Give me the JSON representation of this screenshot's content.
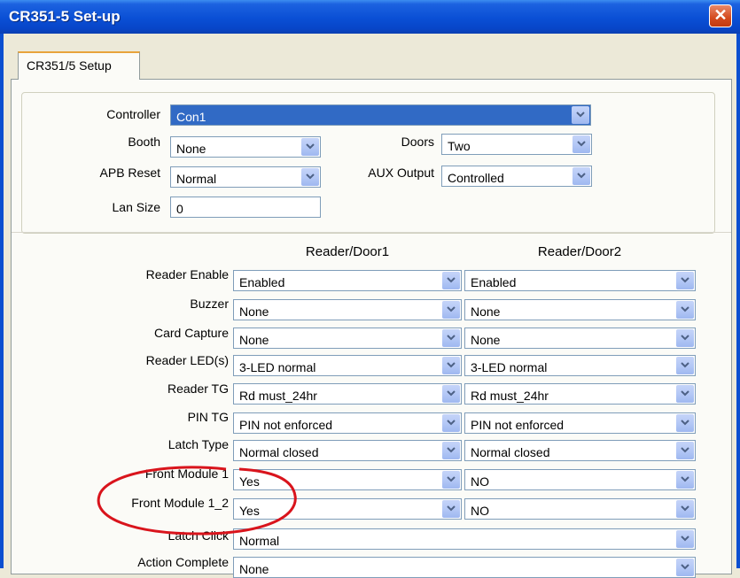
{
  "window": {
    "title": "CR351-5 Set-up",
    "close_glyph": "✕"
  },
  "tab": {
    "label": "CR351/5 Setup"
  },
  "controller": {
    "label": "Controller",
    "value": "Con1"
  },
  "booth": {
    "label": "Booth",
    "value": "None"
  },
  "doors": {
    "label": "Doors",
    "value": "Two"
  },
  "apb_reset": {
    "label": "APB Reset",
    "value": "Normal"
  },
  "aux_output": {
    "label": "AUX Output",
    "value": "Controlled"
  },
  "lan_size": {
    "label": "Lan Size",
    "value": "0"
  },
  "columns": {
    "door1": "Reader/Door1",
    "door2": "Reader/Door2"
  },
  "rows": [
    {
      "label": "Reader Enable",
      "door1": "Enabled",
      "door2": "Enabled"
    },
    {
      "label": "Buzzer",
      "door1": "None",
      "door2": "None"
    },
    {
      "label": "Card Capture",
      "door1": "None",
      "door2": "None"
    },
    {
      "label": "Reader LED(s)",
      "door1": "3-LED normal",
      "door2": "3-LED normal"
    },
    {
      "label": "Reader TG",
      "door1": "Rd must_24hr",
      "door2": "Rd must_24hr"
    },
    {
      "label": "PIN TG",
      "door1": "PIN not enforced",
      "door2": "PIN not enforced"
    },
    {
      "label": "Latch Type",
      "door1": "Normal closed",
      "door2": "Normal closed"
    },
    {
      "label": "Front Module 1",
      "door1": "Yes",
      "door2": "NO"
    },
    {
      "label": "Front Module 1_2",
      "door1": "Yes",
      "door2": "NO"
    }
  ],
  "latch_click": {
    "label": "Latch Click",
    "value": "Normal"
  },
  "action_complete": {
    "label": "Action Complete",
    "value": "None"
  },
  "colors": {
    "title_bar": "#0a4fd5",
    "selection": "#316ac5",
    "annotation": "#d9141c"
  },
  "icons": {
    "dropdown": "chevron-down-icon",
    "close": "close-icon"
  }
}
